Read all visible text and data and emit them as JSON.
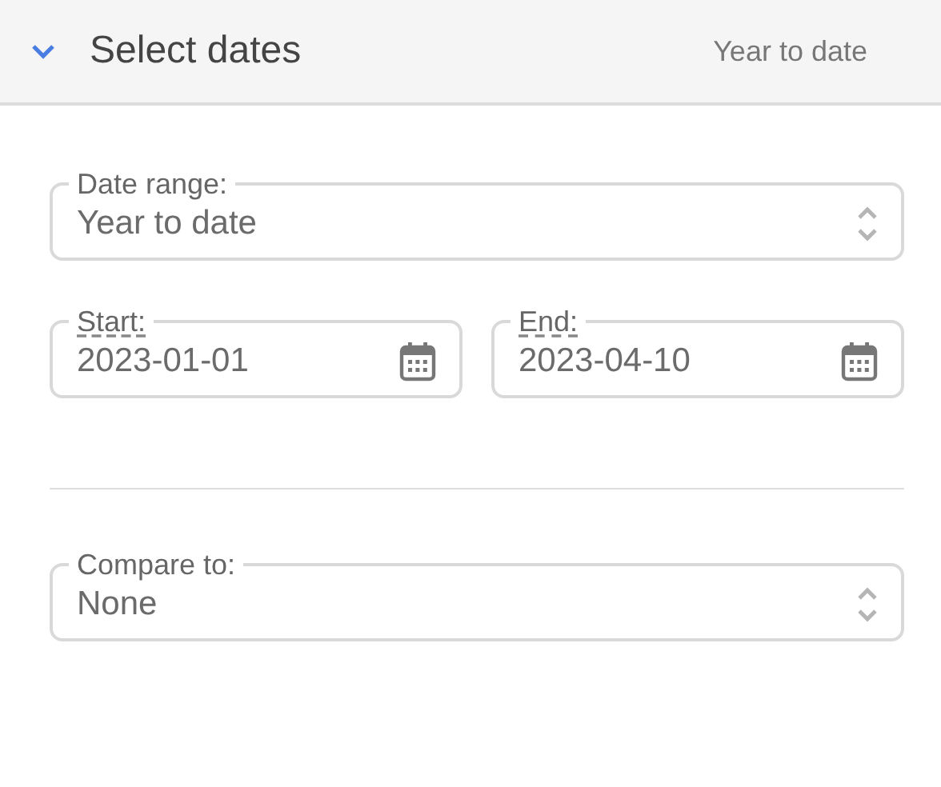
{
  "header": {
    "title": "Select dates",
    "summary": "Year to date",
    "expanded": true
  },
  "date_range": {
    "kind": "select",
    "label": "Date range:",
    "value": "Year to date"
  },
  "period": [
    {
      "kind": "date",
      "label": "Start:",
      "value": "2023-01-01"
    },
    {
      "kind": "date",
      "label": "End:",
      "value": "2023-04-10"
    }
  ],
  "compare": {
    "kind": "select",
    "label": "Compare to:",
    "value": "None"
  }
}
